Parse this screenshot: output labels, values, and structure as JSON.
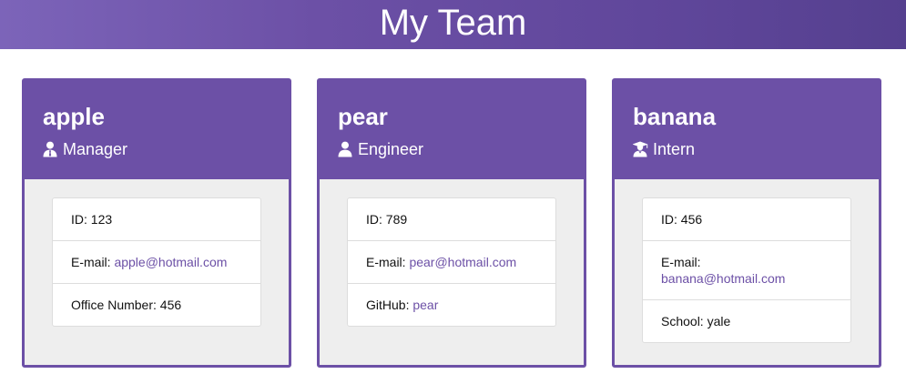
{
  "page": {
    "title": "My Team"
  },
  "colors": {
    "accent": "#6c50a6",
    "card_bg": "#eeeeee",
    "link": "#6c50a6"
  },
  "cards": [
    {
      "name": "apple",
      "role": "Manager",
      "role_icon": "manager-icon",
      "rows": [
        {
          "label": "ID: ",
          "value": "123"
        },
        {
          "label": "E-mail: ",
          "value": "apple@hotmail.com"
        },
        {
          "label": "Office Number: ",
          "value": "456"
        }
      ]
    },
    {
      "name": "pear",
      "role": "Engineer",
      "role_icon": "engineer-icon",
      "rows": [
        {
          "label": "ID: ",
          "value": "789"
        },
        {
          "label": "E-mail: ",
          "value": "pear@hotmail.com"
        },
        {
          "label": "GitHub: ",
          "value": "pear"
        }
      ]
    },
    {
      "name": "banana",
      "role": "Intern",
      "role_icon": "graduate-icon",
      "rows": [
        {
          "label": "ID: ",
          "value": "456"
        },
        {
          "label": "E-mail:",
          "value": "banana@hotmail.com"
        },
        {
          "label": "School: ",
          "value": "yale"
        }
      ]
    }
  ]
}
